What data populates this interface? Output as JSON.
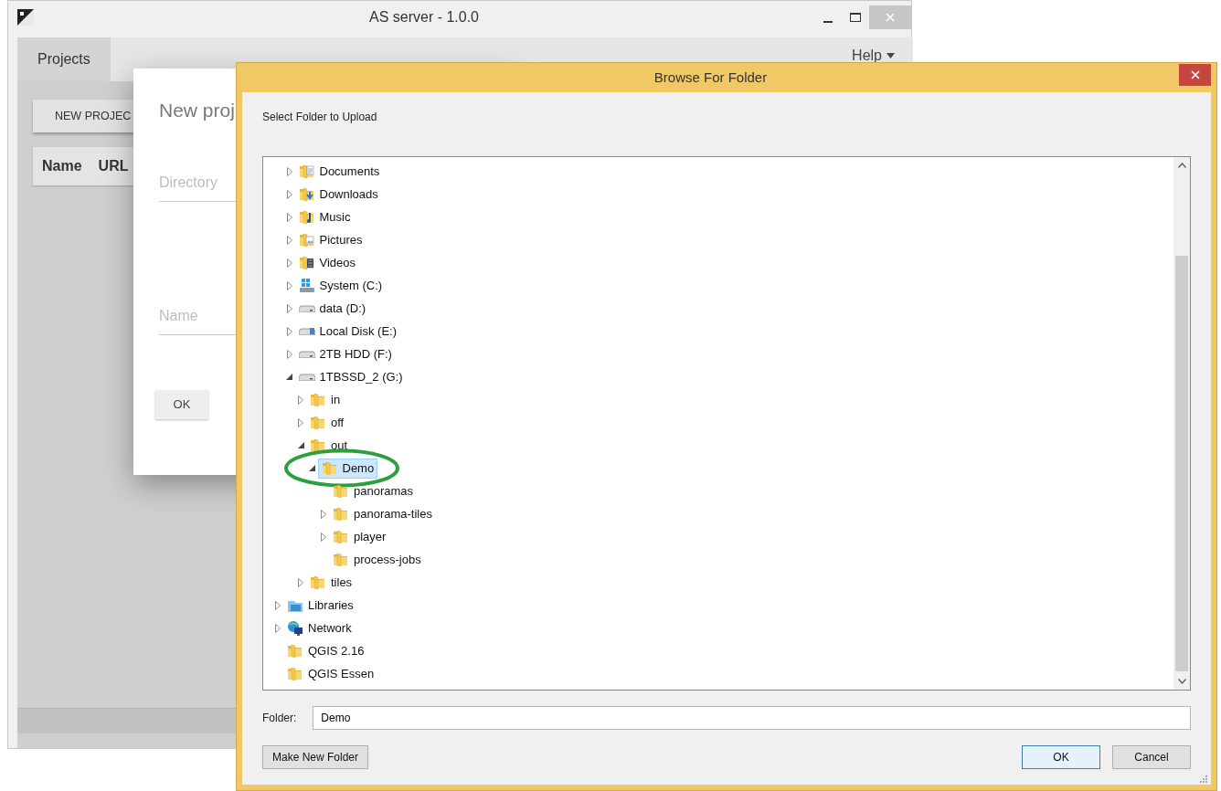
{
  "main_window": {
    "title": "AS server - 1.0.0",
    "tabs": [
      {
        "label": "Projects",
        "selected": true
      }
    ],
    "menu": {
      "label": "Help"
    },
    "new_project_button": "NEW PROJEC",
    "table": {
      "columns": [
        "Name",
        "URL"
      ]
    }
  },
  "new_project_dialog": {
    "title": "New proj",
    "fields": [
      {
        "placeholder": "Directory"
      },
      {
        "placeholder": "Name"
      }
    ],
    "ok_button": "OK"
  },
  "browse_dialog": {
    "title": "Browse For Folder",
    "prompt": "Select Folder to Upload",
    "tree": {
      "continued_items": [
        {
          "label": "Documents",
          "kind": "documents",
          "expandable": true,
          "expanded": false,
          "selected": false
        },
        {
          "label": "Downloads",
          "kind": "downloads",
          "expandable": true,
          "expanded": false,
          "selected": false
        },
        {
          "label": "Music",
          "kind": "music",
          "expandable": true,
          "expanded": false,
          "selected": false
        },
        {
          "label": "Pictures",
          "kind": "pictures",
          "expandable": true,
          "expanded": false,
          "selected": false
        },
        {
          "label": "Videos",
          "kind": "videos",
          "expandable": true,
          "expanded": false,
          "selected": false
        },
        {
          "label": "System (C:)",
          "kind": "system",
          "expandable": true,
          "expanded": false,
          "selected": false
        },
        {
          "label": "data (D:)",
          "kind": "drive",
          "expandable": true,
          "expanded": false,
          "selected": false
        },
        {
          "label": "Local Disk (E:)",
          "kind": "disk",
          "expandable": true,
          "expanded": false,
          "selected": false
        },
        {
          "label": "2TB HDD (F:)",
          "kind": "drive",
          "expandable": true,
          "expanded": false,
          "selected": false
        },
        {
          "label": "1TBSSD_2 (G:)",
          "kind": "drive",
          "expandable": true,
          "expanded": true,
          "selected": false,
          "children": [
            {
              "label": "in",
              "kind": "folder",
              "expandable": true,
              "expanded": false,
              "selected": false
            },
            {
              "label": "off",
              "kind": "folder",
              "expandable": true,
              "expanded": false,
              "selected": false
            },
            {
              "label": "out",
              "kind": "folder",
              "expandable": true,
              "expanded": true,
              "selected": false,
              "children": [
                {
                  "label": "Demo",
                  "kind": "folder",
                  "expandable": true,
                  "expanded": true,
                  "selected": true,
                  "children": [
                    {
                      "label": "panoramas",
                      "kind": "folder",
                      "expandable": false,
                      "selected": false
                    },
                    {
                      "label": "panorama-tiles",
                      "kind": "folder",
                      "expandable": true,
                      "expanded": false,
                      "selected": false
                    },
                    {
                      "label": "player",
                      "kind": "folder",
                      "expandable": true,
                      "expanded": false,
                      "selected": false
                    },
                    {
                      "label": "process-jobs",
                      "kind": "folder",
                      "expandable": false,
                      "selected": false
                    }
                  ]
                }
              ]
            },
            {
              "label": "tiles",
              "kind": "folder",
              "expandable": true,
              "expanded": false,
              "selected": false
            }
          ]
        }
      ],
      "items": [
        {
          "label": "Libraries",
          "kind": "libraries",
          "expandable": true,
          "expanded": false,
          "selected": false
        },
        {
          "label": "Network",
          "kind": "network",
          "expandable": true,
          "expanded": false,
          "selected": false
        },
        {
          "label": "QGIS 2.16",
          "kind": "folder",
          "expandable": false,
          "selected": false
        },
        {
          "label": "QGIS Essen",
          "kind": "folder",
          "expandable": false,
          "selected": false
        }
      ]
    },
    "folder_label": "Folder:",
    "folder_value": "Demo",
    "buttons": [
      {
        "label": "Make New Folder",
        "default": false
      },
      {
        "label": "OK",
        "default": true
      },
      {
        "label": "Cancel",
        "default": false
      }
    ]
  }
}
